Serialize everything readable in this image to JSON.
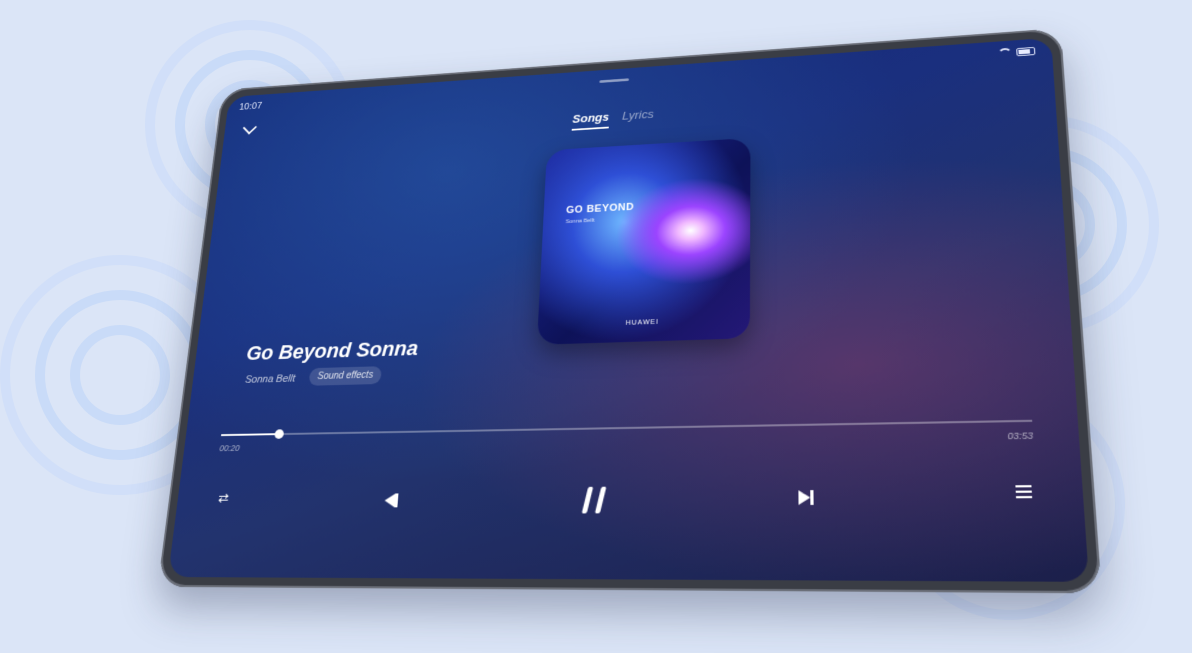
{
  "status_bar": {
    "time": "10:07"
  },
  "player": {
    "tabs": [
      {
        "label": "Songs",
        "active": true
      },
      {
        "label": "Lyrics",
        "active": false
      }
    ],
    "album": {
      "cover_title": "GO BEYOND",
      "cover_subtitle": "Sonna Bellt",
      "cover_brand": "HUAWEI"
    },
    "song_title": "Go Beyond Sonna",
    "artist": "Sonna Bellt",
    "sound_effects_label": "Sound effects",
    "progress": {
      "elapsed": "00:20",
      "total": "03:53",
      "fraction": 0.08
    },
    "icons": {
      "repeat": "repeat-icon",
      "previous": "previous-icon",
      "pause": "pause-icon",
      "next": "next-icon",
      "playlist": "playlist-icon"
    }
  },
  "colors": {
    "background": "#dbe5f7",
    "screen_top": "#142a78",
    "accent": "#ffffff"
  }
}
